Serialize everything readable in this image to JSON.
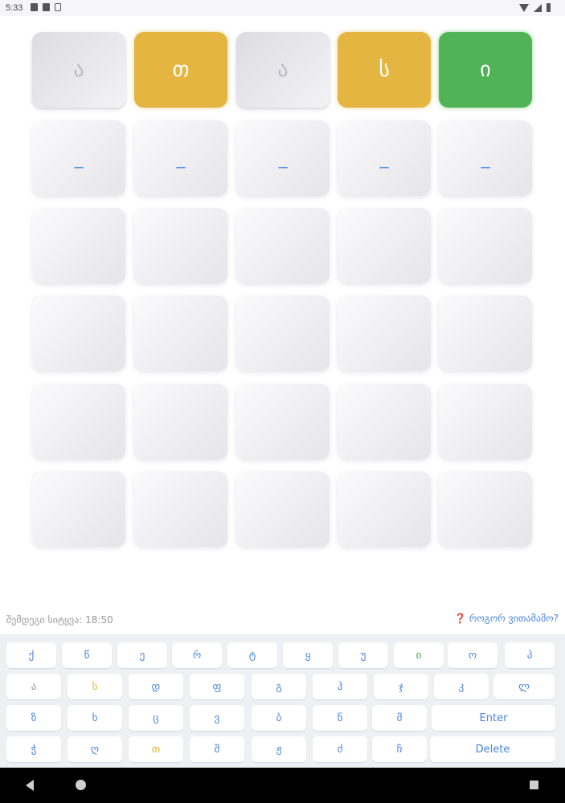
{
  "status_bar": {
    "time": "5:33"
  },
  "board": {
    "rows": [
      [
        {
          "letter": "ა",
          "state": "gray"
        },
        {
          "letter": "თ",
          "state": "yellow"
        },
        {
          "letter": "ა",
          "state": "gray"
        },
        {
          "letter": "ს",
          "state": "yellow"
        },
        {
          "letter": "ი",
          "state": "green"
        }
      ],
      [
        {
          "letter": "_",
          "state": "cursor"
        },
        {
          "letter": "_",
          "state": "cursor"
        },
        {
          "letter": "_",
          "state": "cursor"
        },
        {
          "letter": "_",
          "state": "cursor"
        },
        {
          "letter": "_",
          "state": "cursor"
        }
      ],
      [
        {
          "letter": "",
          "state": "empty"
        },
        {
          "letter": "",
          "state": "empty"
        },
        {
          "letter": "",
          "state": "empty"
        },
        {
          "letter": "",
          "state": "empty"
        },
        {
          "letter": "",
          "state": "empty"
        }
      ],
      [
        {
          "letter": "",
          "state": "empty"
        },
        {
          "letter": "",
          "state": "empty"
        },
        {
          "letter": "",
          "state": "empty"
        },
        {
          "letter": "",
          "state": "empty"
        },
        {
          "letter": "",
          "state": "empty"
        }
      ],
      [
        {
          "letter": "",
          "state": "empty"
        },
        {
          "letter": "",
          "state": "empty"
        },
        {
          "letter": "",
          "state": "empty"
        },
        {
          "letter": "",
          "state": "empty"
        },
        {
          "letter": "",
          "state": "empty"
        }
      ],
      [
        {
          "letter": "",
          "state": "empty"
        },
        {
          "letter": "",
          "state": "empty"
        },
        {
          "letter": "",
          "state": "empty"
        },
        {
          "letter": "",
          "state": "empty"
        },
        {
          "letter": "",
          "state": "empty"
        }
      ]
    ]
  },
  "info": {
    "next_word_label": "შემდეგი სიტყვა: 18:50",
    "how_to_play": "❓ როგორ ვითამაშო?"
  },
  "keyboard": {
    "rows": [
      [
        {
          "label": "ქ",
          "state": "default"
        },
        {
          "label": "წ",
          "state": "default"
        },
        {
          "label": "ე",
          "state": "default"
        },
        {
          "label": "რ",
          "state": "default"
        },
        {
          "label": "ტ",
          "state": "default"
        },
        {
          "label": "ყ",
          "state": "default"
        },
        {
          "label": "უ",
          "state": "default"
        },
        {
          "label": "ი",
          "state": "green"
        },
        {
          "label": "ო",
          "state": "default"
        },
        {
          "label": "პ",
          "state": "default"
        }
      ],
      [
        {
          "label": "ა",
          "state": "gray"
        },
        {
          "label": "ს",
          "state": "yellow"
        },
        {
          "label": "დ",
          "state": "default"
        },
        {
          "label": "ფ",
          "state": "default"
        },
        {
          "label": "გ",
          "state": "default"
        },
        {
          "label": "ჰ",
          "state": "default"
        },
        {
          "label": "ჯ",
          "state": "default"
        },
        {
          "label": "კ",
          "state": "default"
        },
        {
          "label": "ლ",
          "state": "default"
        }
      ],
      [
        {
          "label": "ზ",
          "state": "default"
        },
        {
          "label": "ხ",
          "state": "default"
        },
        {
          "label": "ც",
          "state": "default"
        },
        {
          "label": "ვ",
          "state": "default"
        },
        {
          "label": "ბ",
          "state": "default"
        },
        {
          "label": "ნ",
          "state": "default"
        },
        {
          "label": "მ",
          "state": "default"
        },
        {
          "label": "Enter",
          "state": "default"
        }
      ],
      [
        {
          "label": "ჭ",
          "state": "default"
        },
        {
          "label": "ღ",
          "state": "default"
        },
        {
          "label": "თ",
          "state": "yellow"
        },
        {
          "label": "შ",
          "state": "default"
        },
        {
          "label": "ჟ",
          "state": "default"
        },
        {
          "label": "ძ",
          "state": "default"
        },
        {
          "label": "ჩ",
          "state": "default"
        },
        {
          "label": "Delete",
          "state": "default"
        }
      ]
    ]
  },
  "colors": {
    "correct": "#50b356",
    "present": "#e4b541",
    "absent": "#dcdce1",
    "key_text": "#4a86d8",
    "cursor": "#5b94e0"
  }
}
